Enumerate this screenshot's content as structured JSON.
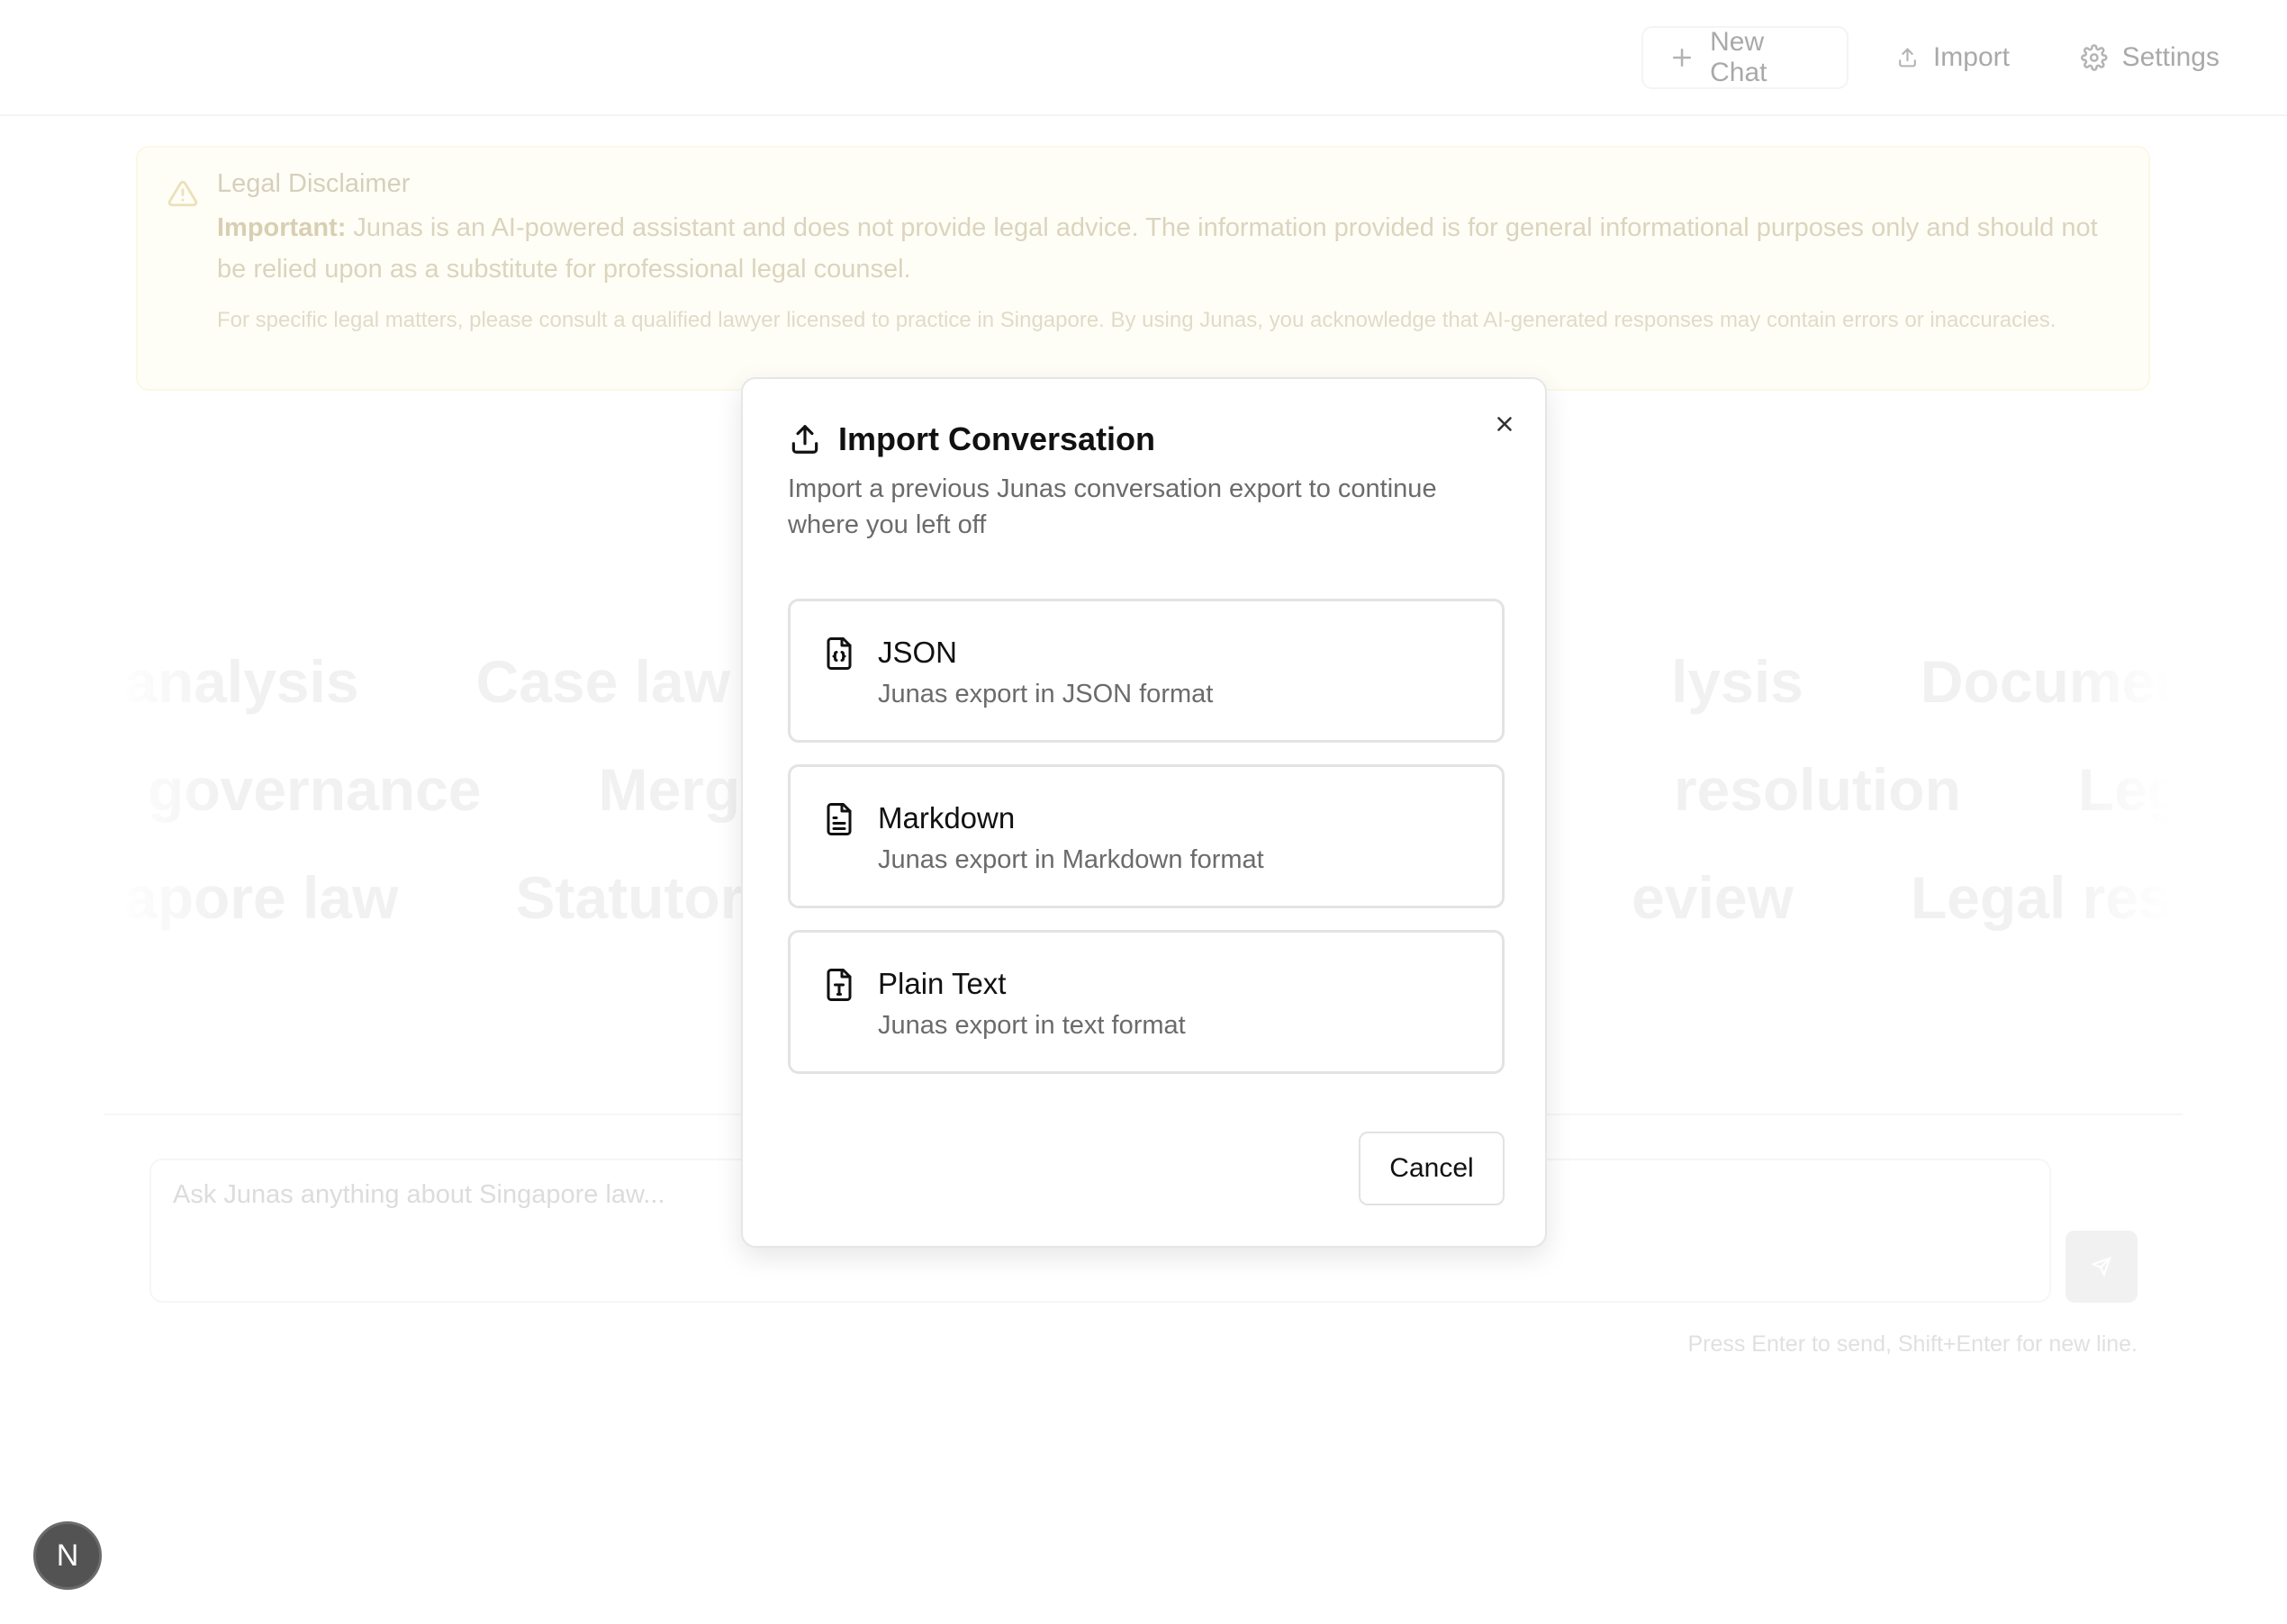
{
  "header": {
    "new_chat_label": "New Chat",
    "import_label": "Import",
    "settings_label": "Settings"
  },
  "disclaimer": {
    "title": "Legal Disclaimer",
    "important_prefix": "Important:",
    "body": " Junas is an AI-powered assistant and does not provide legal advice. The information provided is for general informational purposes only and should not be relied upon as a substitute for professional legal counsel.",
    "small": "For specific legal matters, please consult a qualified lawyer licensed to practice in Singapore. By using Junas, you acknowledge that AI-generated responses may contain errors or inaccuracies."
  },
  "marquee": {
    "row1": [
      "analysis",
      "Case law a",
      "lysis",
      "Document drafti"
    ],
    "row2": [
      "governance",
      "Merge",
      "resolution",
      "Legal opini"
    ],
    "row3": [
      "apore law",
      "Statutory",
      "eview",
      "Legal researc"
    ]
  },
  "input": {
    "placeholder": "Ask Junas anything about Singapore law...",
    "hint": "Press Enter to send, Shift+Enter for new line."
  },
  "badge": {
    "letter": "N"
  },
  "modal": {
    "title": "Import Conversation",
    "description": "Import a previous Junas conversation export to continue where you left off",
    "options": [
      {
        "label": "JSON",
        "desc": "Junas export in JSON format",
        "icon": "file-json-icon"
      },
      {
        "label": "Markdown",
        "desc": "Junas export in Markdown format",
        "icon": "file-text-icon"
      },
      {
        "label": "Plain Text",
        "desc": "Junas export in text format",
        "icon": "file-type-icon"
      }
    ],
    "cancel_label": "Cancel"
  }
}
